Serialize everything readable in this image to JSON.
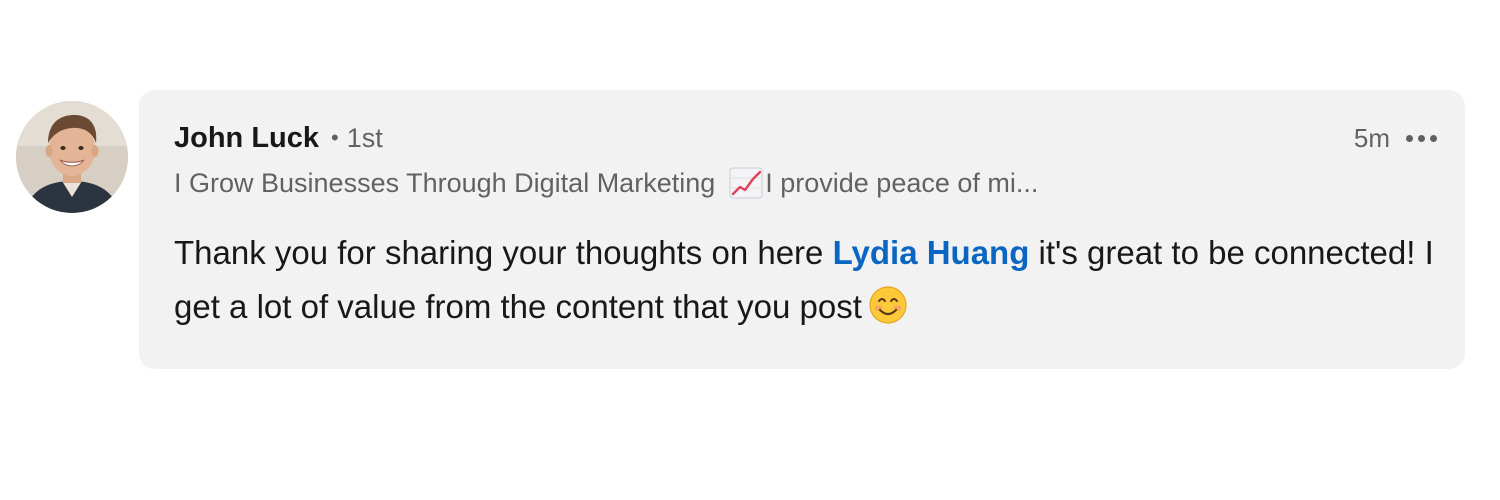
{
  "comment": {
    "author": {
      "name": "John Luck",
      "separator": "•",
      "degree": "1st",
      "avatar_icon": "profile-photo",
      "headline_before_emoji": "I Grow Businesses Through Digital Marketing",
      "headline_emoji_icon": "chart-increasing-icon",
      "headline_after_emoji": "I provide peace of mi..."
    },
    "timestamp": "5m",
    "more_icon": "ellipsis-icon",
    "body": {
      "text_before_mention": "Thank you for sharing your thoughts on here ",
      "mention": "Lydia Huang",
      "text_after_mention": " it's great to be connected! I get a lot of value from the content that you post",
      "trailing_emoji_icon": "smiling-face-icon"
    }
  },
  "colors": {
    "bubble_background": "#f2f2f2",
    "mention": "#0a66c2",
    "primary_text": "#191919",
    "secondary_text": "#666666"
  }
}
